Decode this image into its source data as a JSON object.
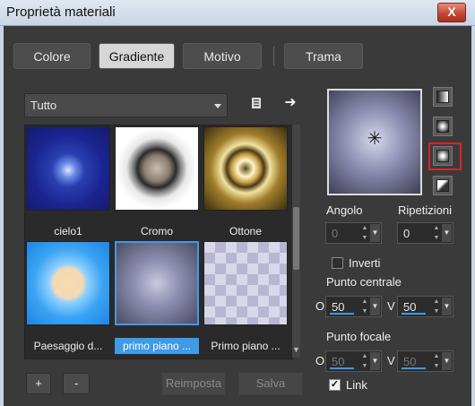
{
  "window": {
    "title": "Proprietà materiali",
    "close_label": "X"
  },
  "tabs": [
    {
      "label": "Colore",
      "active": false
    },
    {
      "label": "Gradiente",
      "active": true
    },
    {
      "label": "Motivo",
      "active": false
    },
    {
      "label": "Trama",
      "active": false
    }
  ],
  "library": {
    "category": "Tutto",
    "items": [
      {
        "label": "cielo1",
        "style": "radial-deep-blue"
      },
      {
        "label": "Cromo",
        "style": "radial-chrome-ring"
      },
      {
        "label": "Ottone",
        "style": "radial-brass-ring"
      },
      {
        "label": "Paesaggio d...",
        "style": "radial-sky-peach"
      },
      {
        "label": "primo piano ...",
        "style": "radial-lavender",
        "selected": true
      },
      {
        "label": "Primo piano ...",
        "style": "checker-transparent"
      }
    ]
  },
  "bottom_buttons": {
    "add": "+",
    "remove": "-",
    "reset": "Reimposta",
    "save": "Salva"
  },
  "editor": {
    "gradient_types": [
      "linear-icon",
      "rectangular-icon",
      "radial-icon",
      "sunburst-icon"
    ],
    "selected_type": "radial-icon",
    "angle_label": "Angolo",
    "angle_value": "0",
    "repeats_label": "Ripetizioni",
    "repeats_value": "0",
    "invert_label": "Inverti",
    "invert_checked": false,
    "center_label": "Punto centrale",
    "center_h_label": "O",
    "center_h": "50",
    "center_v_label": "V",
    "center_v": "50",
    "focal_label": "Punto focale",
    "focal_h_label": "O",
    "focal_h": "50",
    "focal_v_label": "V",
    "focal_v": "50",
    "link_label": "Link",
    "link_checked": true
  },
  "colors": {
    "accent": "#3f9ae8",
    "highlight": "#d9252b"
  }
}
